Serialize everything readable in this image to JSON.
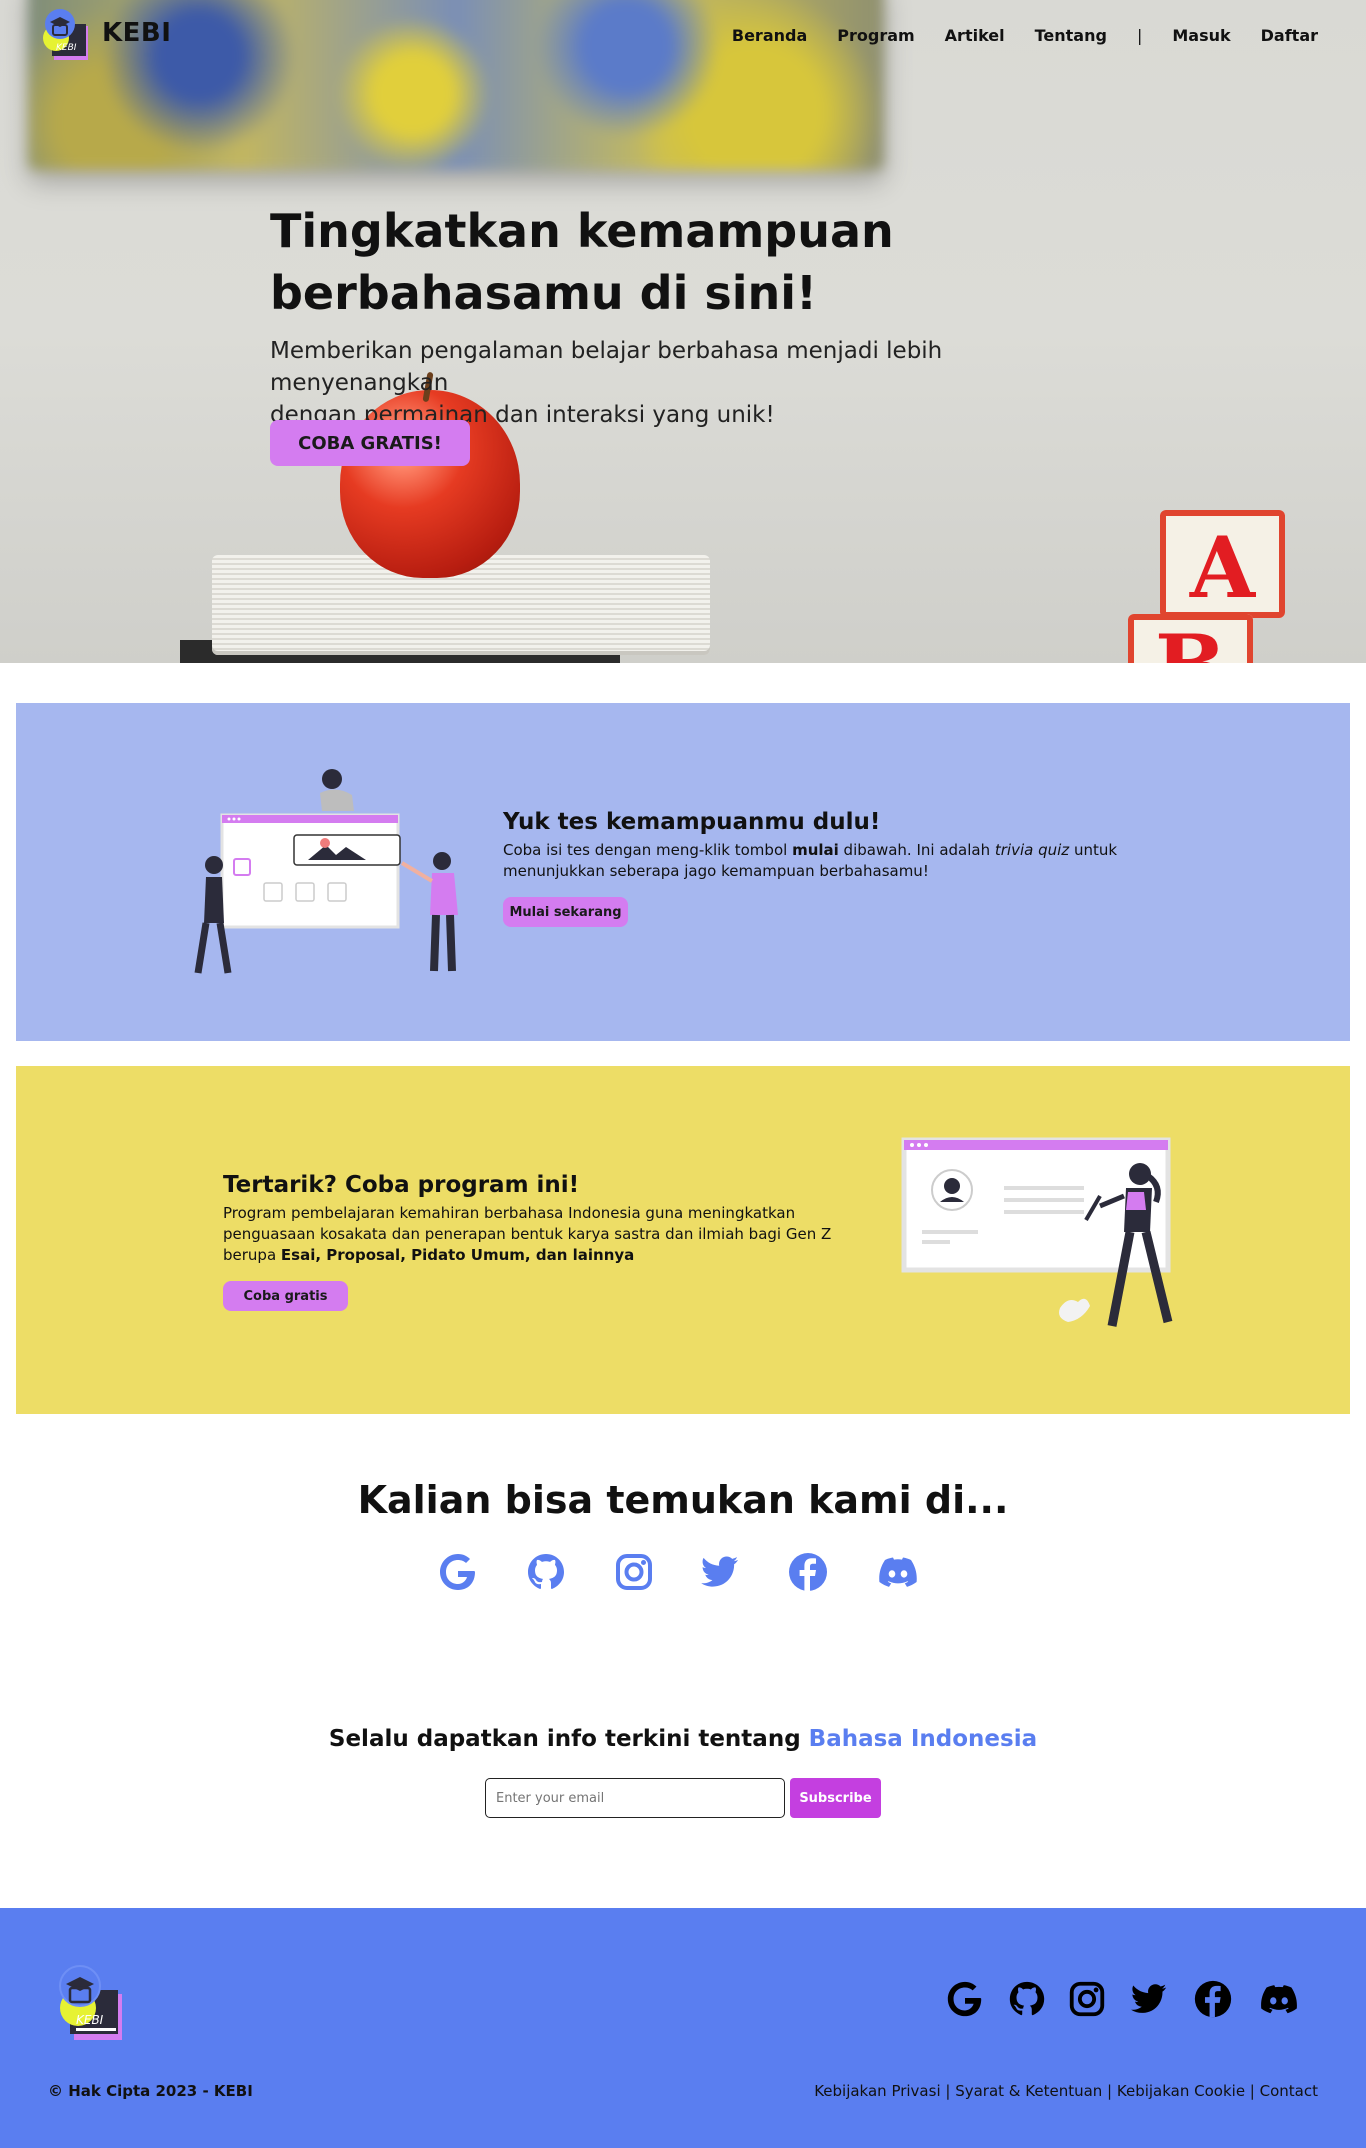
{
  "brand": {
    "name": "KEBI",
    "logo_text": "KEBI"
  },
  "nav": {
    "items": [
      "Beranda",
      "Program",
      "Artikel",
      "Tentang",
      "|",
      "Masuk",
      "Daftar"
    ]
  },
  "hero": {
    "title_line1": "Tingkatkan kemampuan",
    "title_line2": "berbahasamu di sini!",
    "subtitle_line1": "Memberikan pengalaman belajar berbahasa menjadi lebih menyenangkan",
    "subtitle_line2": "dengan permainan dan interaksi yang unik!",
    "cta": "COBA GRATIS!",
    "block_letters": [
      "A",
      "B"
    ]
  },
  "test_section": {
    "title": "Yuk tes kemampuanmu dulu!",
    "text_1": "Coba isi tes dengan meng-klik tombol ",
    "text_bold": "mulai",
    "text_2": " dibawah. Ini adalah ",
    "text_italic": "trivia quiz",
    "text_3": " untuk menunjukkan seberapa jago kemampuan berbahasamu!",
    "button": "Mulai sekarang"
  },
  "program_section": {
    "title": "Tertarik? Coba program ini!",
    "text_1": "Program pembelajaran kemahiran berbahasa Indonesia guna meningkatkan penguasaan kosakata dan penerapan bentuk karya sastra dan ilmiah bagi Gen Z berupa ",
    "text_bold": "Esai, Proposal, Pidato Umum, dan lainnya",
    "button": "Coba gratis"
  },
  "social": {
    "title": "Kalian bisa temukan kami di...",
    "icons": [
      "google-icon",
      "github-icon",
      "instagram-icon",
      "twitter-icon",
      "facebook-icon",
      "discord-icon"
    ]
  },
  "newsletter": {
    "title_prefix": "Selalu dapatkan info terkini tentang ",
    "title_accent": "Bahasa Indonesia",
    "placeholder": "Enter your email",
    "button": "Subscribe"
  },
  "footer": {
    "copyright": "© Hak Cipta 2023 - KEBI",
    "links": "Kebijakan Privasi | Syarat & Ketentuan | Kebijakan Cookie | Contact"
  },
  "colors": {
    "accent_blue": "#5a7ef0",
    "pill_pink": "#d47cf0",
    "subscribe_purple": "#c43fe0",
    "panel_blue": "#a6b7ef",
    "panel_yellow": "#eddd66"
  }
}
